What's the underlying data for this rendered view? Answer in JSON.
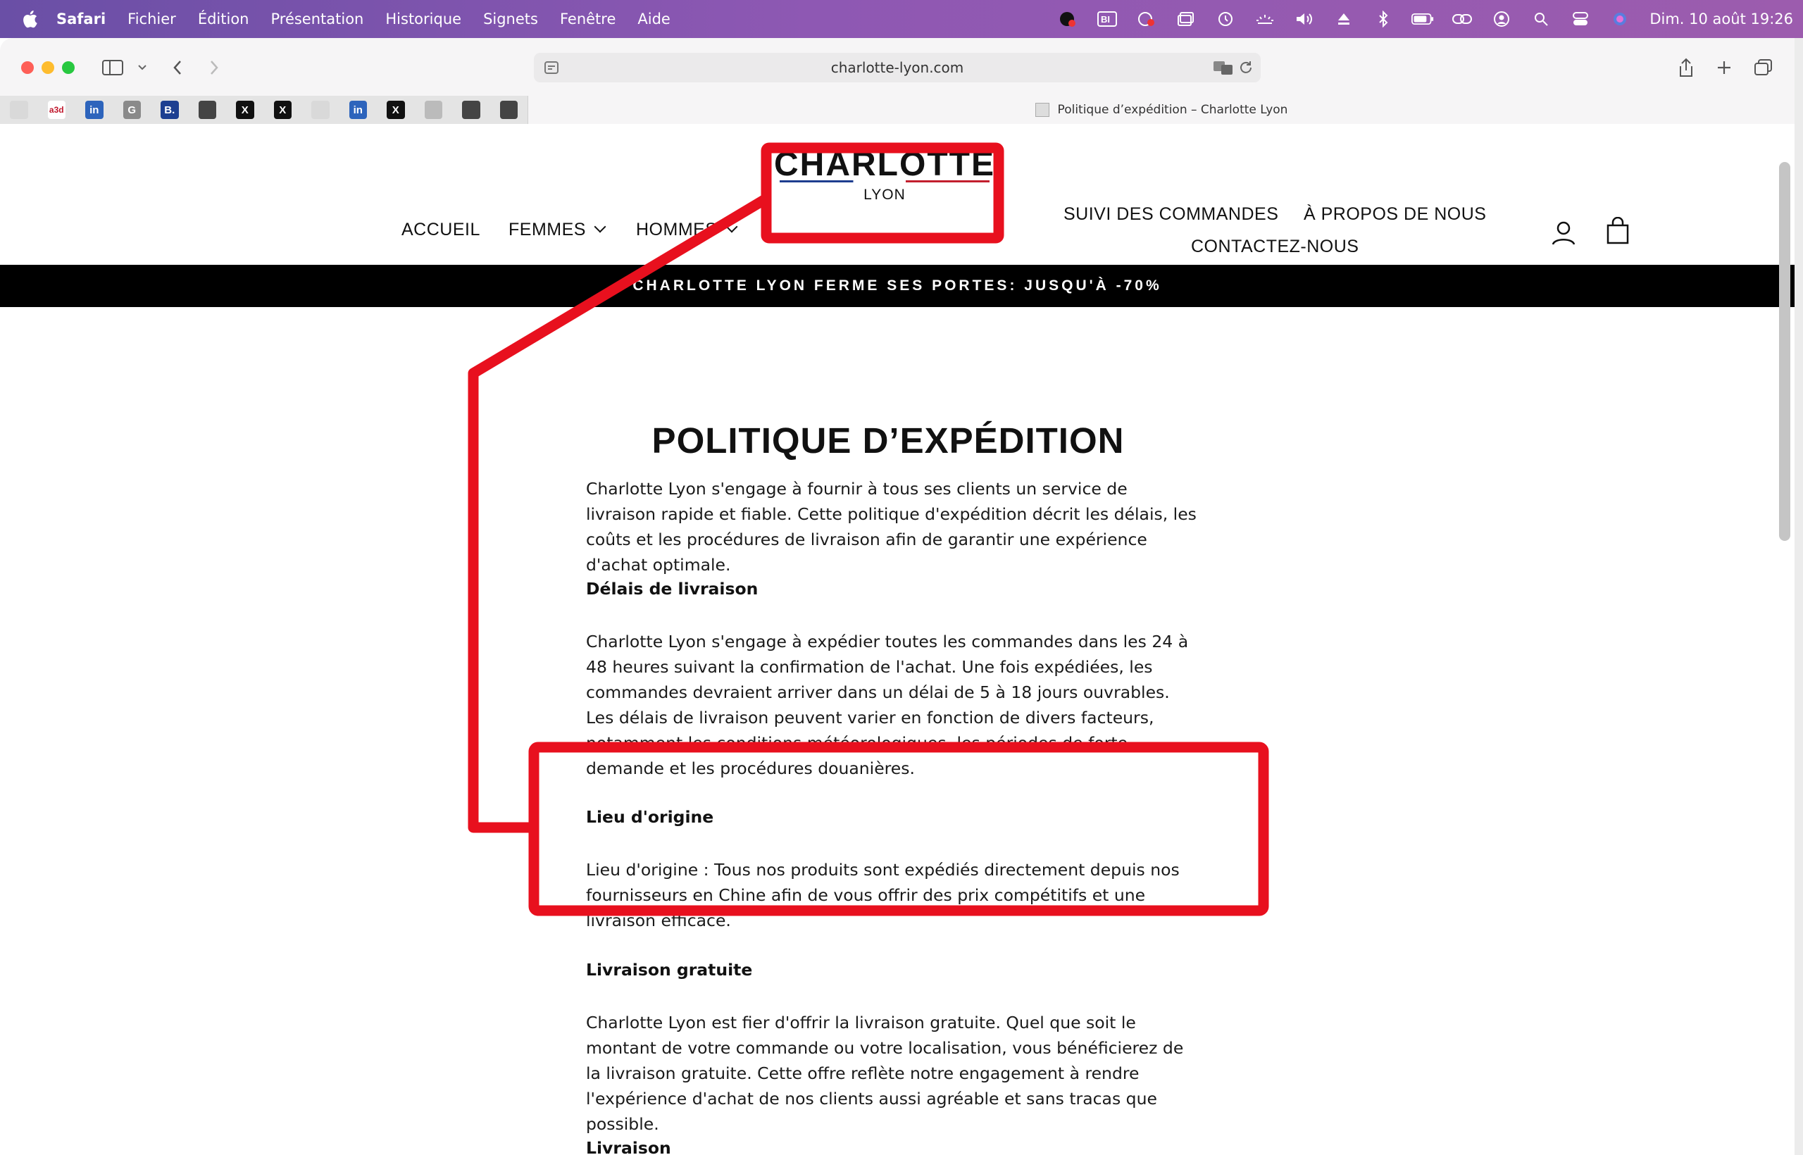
{
  "menubar": {
    "app": "Safari",
    "items": [
      "Fichier",
      "Édition",
      "Présentation",
      "Historique",
      "Signets",
      "Fenêtre",
      "Aide"
    ],
    "clock": "Dim. 10 août  19:26",
    "status_icons": [
      "app-icon",
      "bi-icon",
      "cloud-icon",
      "window-icon",
      "timemachine-icon",
      "brightness-icon",
      "volume-icon",
      "eject-icon",
      "bluetooth-icon",
      "battery-icon",
      "link-icon",
      "user-icon",
      "search-icon",
      "control-center-icon",
      "siri-icon"
    ]
  },
  "browser": {
    "url": "charlotte-lyon.com",
    "active_tab_title": "Politique d’expédition – Charlotte Lyon",
    "pinned_tabs": [
      {
        "name": "pinned-tab-1",
        "label": "",
        "bg": "#d9d9d9"
      },
      {
        "name": "pinned-tab-a3d",
        "label": "a3d",
        "bg": "#ffffff"
      },
      {
        "name": "pinned-tab-linkedin",
        "label": "in",
        "bg": "#2d64bc"
      },
      {
        "name": "pinned-tab-g",
        "label": "G",
        "bg": "#8a8a8a"
      },
      {
        "name": "pinned-tab-b",
        "label": "B.",
        "bg": "#1d3f91"
      },
      {
        "name": "pinned-tab-profile",
        "label": "",
        "bg": "#444444"
      },
      {
        "name": "pinned-tab-x",
        "label": "X",
        "bg": "#111111"
      },
      {
        "name": "pinned-tab-x",
        "label": "X",
        "bg": "#111111"
      },
      {
        "name": "pinned-tab-2",
        "label": "",
        "bg": "#d9d9d9"
      },
      {
        "name": "pinned-tab-linkedin",
        "label": "in",
        "bg": "#2d64bc"
      },
      {
        "name": "pinned-tab-x",
        "label": "X",
        "bg": "#111111"
      },
      {
        "name": "pinned-tab-3",
        "label": "",
        "bg": "#bbbbbb"
      },
      {
        "name": "pinned-tab-profile",
        "label": "",
        "bg": "#444444"
      },
      {
        "name": "pinned-tab-profile",
        "label": "",
        "bg": "#444444"
      }
    ]
  },
  "site": {
    "nav": {
      "home": "ACCUEIL",
      "women": "FEMMES",
      "men": "HOMMES",
      "tracking": "SUIVI DES COMMANDES",
      "about": "À PROPOS DE NOUS",
      "contact": "CONTACTEZ-NOUS"
    },
    "logo": {
      "main": "CHARLOTTE",
      "sub": "LYON"
    },
    "promo": "CHARLOTTE LYON FERME SES PORTES: JUSQU'À -70%"
  },
  "page": {
    "title": "POLITIQUE D’EXPÉDITION",
    "intro": "Charlotte Lyon  s'engage à fournir à tous ses clients un service de livraison rapide et fiable. Cette politique d'expédition décrit les délais, les coûts et les procédures de livraison afin de garantir une expérience d'achat optimale.",
    "sections": [
      {
        "heading": "Délais de livraison",
        "body": "Charlotte Lyon s'engage à expédier toutes les commandes dans les 24 à 48 heures suivant la confirmation de l'achat. Une fois expédiées, les commandes devraient arriver dans un délai de 5 à 18 jours ouvrables. Les délais de livraison peuvent varier en fonction de divers facteurs, notamment les conditions météorologiques, les périodes de forte demande et les procédures douanières."
      },
      {
        "heading": "Lieu d'origine",
        "body": "Lieu d'origine : Tous nos produits sont expédiés directement depuis nos fournisseurs en Chine afin de vous offrir des prix compétitifs et une livraison efficace."
      },
      {
        "heading": "Livraison gratuite",
        "body": "Charlotte Lyon est fier d'offrir la livraison gratuite. Quel que soit le montant de votre commande ou votre localisation, vous bénéficierez de la livraison gratuite. Cette offre reflète notre engagement à rendre l'expérience d'achat de nos clients aussi agréable et sans tracas que possible."
      },
      {
        "heading": "Livraison",
        "body": ""
      }
    ]
  },
  "colors": {
    "annotation": "#e8101e",
    "promo_bg": "#000000",
    "menubar_purple": "#8a55b0"
  }
}
